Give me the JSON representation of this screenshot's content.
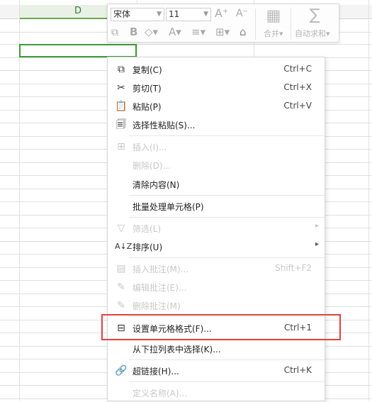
{
  "sheet": {
    "column_header_d": "D"
  },
  "mini_toolbar": {
    "font_name": "宋体",
    "font_size": "11",
    "increase_font_icon": "A⁺",
    "decrease_font_icon": "A⁻",
    "bold_label": "B",
    "merge_label": "合并",
    "autosum_label": "自动求和"
  },
  "context_menu": {
    "items": [
      {
        "label": "复制(C)",
        "shortcut": "Ctrl+C"
      },
      {
        "label": "剪切(T)",
        "shortcut": "Ctrl+X"
      },
      {
        "label": "粘贴(P)",
        "shortcut": "Ctrl+V"
      },
      {
        "label": "选择性粘贴(S)...",
        "shortcut": ""
      },
      {
        "label": "插入(I)...",
        "shortcut": ""
      },
      {
        "label": "删除(D)...",
        "shortcut": ""
      },
      {
        "label": "清除内容(N)",
        "shortcut": ""
      },
      {
        "label": "批量处理单元格(P)",
        "shortcut": ""
      },
      {
        "label": "筛选(L)",
        "shortcut": ""
      },
      {
        "label": "排序(U)",
        "shortcut": ""
      },
      {
        "label": "插入批注(M)...",
        "shortcut": "Shift+F2"
      },
      {
        "label": "编辑批注(E)...",
        "shortcut": ""
      },
      {
        "label": "删除批注(M)",
        "shortcut": ""
      },
      {
        "label": "设置单元格格式(F)...",
        "shortcut": "Ctrl+1"
      },
      {
        "label": "从下拉列表中选择(K)...",
        "shortcut": ""
      },
      {
        "label": "超链接(H)...",
        "shortcut": "Ctrl+K"
      },
      {
        "label": "定义名称(A)...",
        "shortcut": ""
      }
    ]
  }
}
